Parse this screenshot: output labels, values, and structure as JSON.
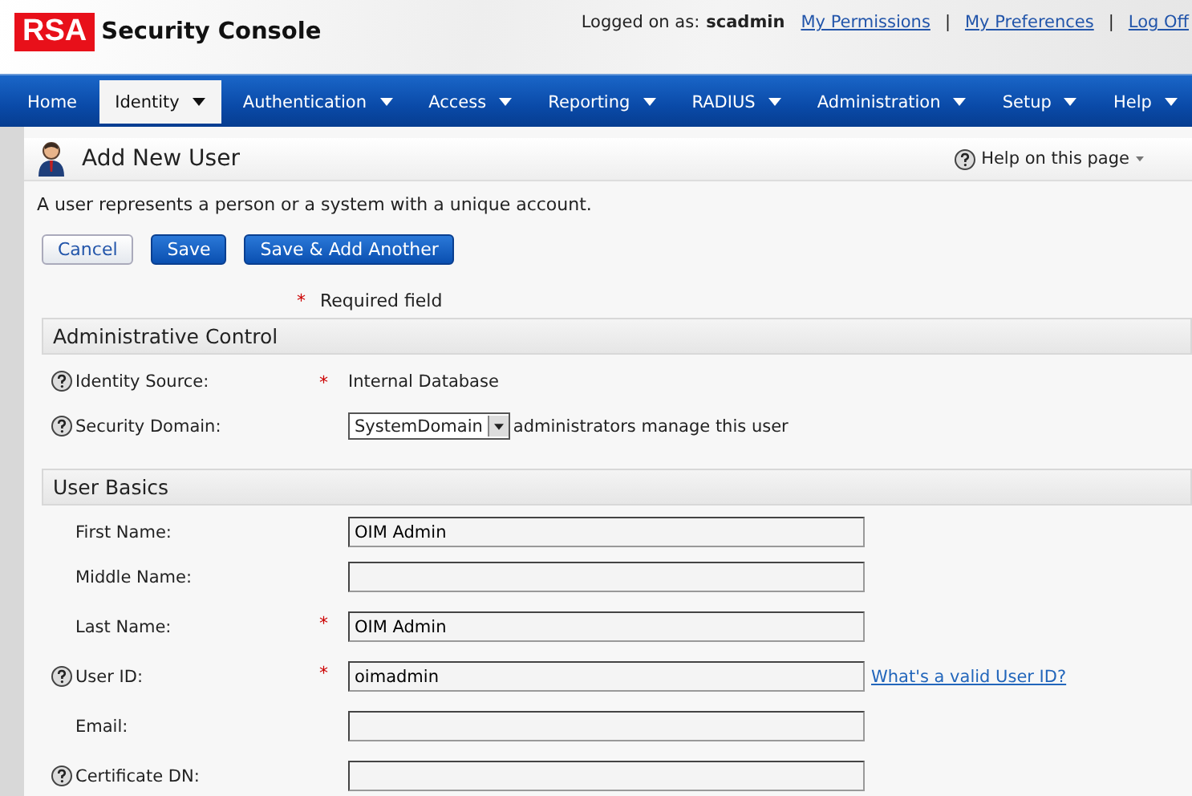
{
  "header": {
    "logo": "RSA",
    "product": "Security Console",
    "logged_on_label": "Logged on as:",
    "user": "scadmin",
    "links": [
      "My Permissions",
      "My Preferences",
      "Log Off"
    ],
    "separators": [
      "|",
      "|"
    ]
  },
  "nav": [
    {
      "label": "Home",
      "selected": false,
      "menu": false
    },
    {
      "label": "Identity",
      "selected": true,
      "menu": true
    },
    {
      "label": "Authentication",
      "selected": false,
      "menu": true
    },
    {
      "label": "Access",
      "selected": false,
      "menu": true
    },
    {
      "label": "Reporting",
      "selected": false,
      "menu": true
    },
    {
      "label": "RADIUS",
      "selected": false,
      "menu": true
    },
    {
      "label": "Administration",
      "selected": false,
      "menu": true
    },
    {
      "label": "Setup",
      "selected": false,
      "menu": true
    },
    {
      "label": "Help",
      "selected": false,
      "menu": true
    }
  ],
  "page": {
    "title": "Add New User",
    "help": "Help on this page",
    "description": "A user represents a person or a system with a unique account."
  },
  "buttons": [
    {
      "label": "Cancel",
      "kind": "secondary"
    },
    {
      "label": "Save",
      "kind": "primary"
    },
    {
      "label": "Save & Add Another",
      "kind": "primary"
    }
  ],
  "required_note": {
    "marker": "*",
    "text": "Required field"
  },
  "sections": [
    {
      "title": "Administrative Control",
      "fields": [
        {
          "label": "Identity Source:",
          "kind": "static",
          "help": true,
          "marker": "*",
          "value": "Internal Database"
        },
        {
          "label": "Security Domain:",
          "kind": "select",
          "help": true,
          "value": "SystemDomain",
          "suffix": "administrators manage this user"
        }
      ]
    },
    {
      "title": "User Basics",
      "fields": [
        {
          "label": "First Name:",
          "kind": "input",
          "help": false,
          "value": "OIM Admin"
        },
        {
          "label": "Middle Name:",
          "kind": "input",
          "help": false
        },
        {
          "label": "Last Name:",
          "kind": "input",
          "help": false,
          "marker": "*",
          "value": "OIM Admin"
        },
        {
          "label": "User ID:",
          "kind": "input",
          "help": true,
          "marker": "*",
          "value": "oimadmin",
          "link": "What's a valid User ID?"
        },
        {
          "label": "Email:",
          "kind": "input",
          "help": false
        },
        {
          "label": "Certificate DN:",
          "kind": "input",
          "help": true
        }
      ]
    }
  ]
}
